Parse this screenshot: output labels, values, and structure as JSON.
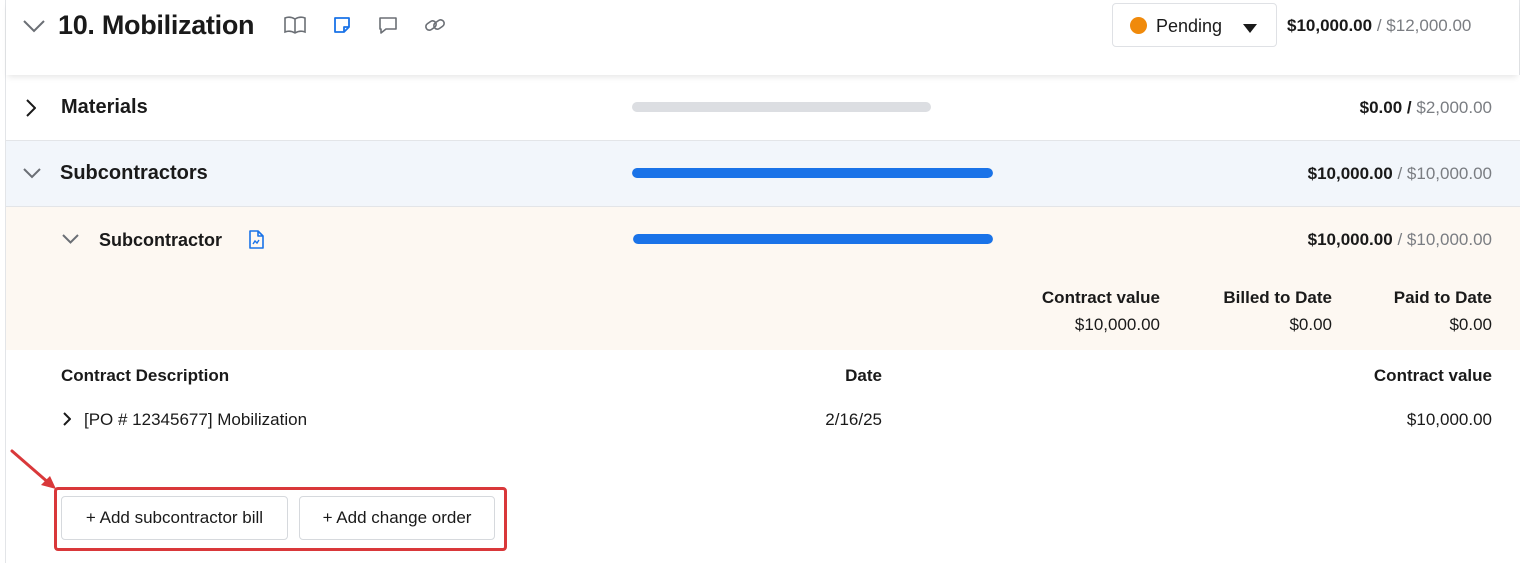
{
  "header": {
    "title": "10. Mobilization",
    "status": {
      "label": "Pending",
      "color": "#f08a0b"
    },
    "amount": "$10,000.00",
    "separator": "/",
    "total": "$12,000.00"
  },
  "icons": {
    "collapse": "chevron-down-icon",
    "book": "book-icon",
    "note": "note-icon",
    "comment": "comment-icon",
    "link": "link-icon",
    "document": "document-icon",
    "expand": "chevron-right-icon"
  },
  "colors": {
    "accent": "#1a73e8",
    "pending": "#f08a0b",
    "highlight": "#d9383a"
  },
  "materials": {
    "label": "Materials",
    "progress": 0,
    "amount": "$0.00",
    "separator": "/",
    "total": "$2,000.00"
  },
  "subcontractors": {
    "label": "Subcontractors",
    "progress": 1.0,
    "amount": "$10,000.00",
    "separator": "/",
    "total": "$10,000.00"
  },
  "subcontractor": {
    "label": "Subcontractor",
    "progress": 1.0,
    "amount": "$10,000.00",
    "separator": "/",
    "total": "$10,000.00",
    "stats": [
      {
        "label": "Contract value",
        "value": "$10,000.00"
      },
      {
        "label": "Billed to Date",
        "value": "$0.00"
      },
      {
        "label": "Paid to Date",
        "value": "$0.00"
      }
    ]
  },
  "table": {
    "columns": [
      "Contract Description",
      "Date",
      "Contract value"
    ],
    "rows": [
      {
        "description": "[PO # 12345677] Mobilization",
        "date": "2/16/25",
        "value": "$10,000.00"
      }
    ]
  },
  "actions": {
    "add_bill": "+ Add subcontractor bill",
    "add_change_order": "+ Add change order"
  }
}
